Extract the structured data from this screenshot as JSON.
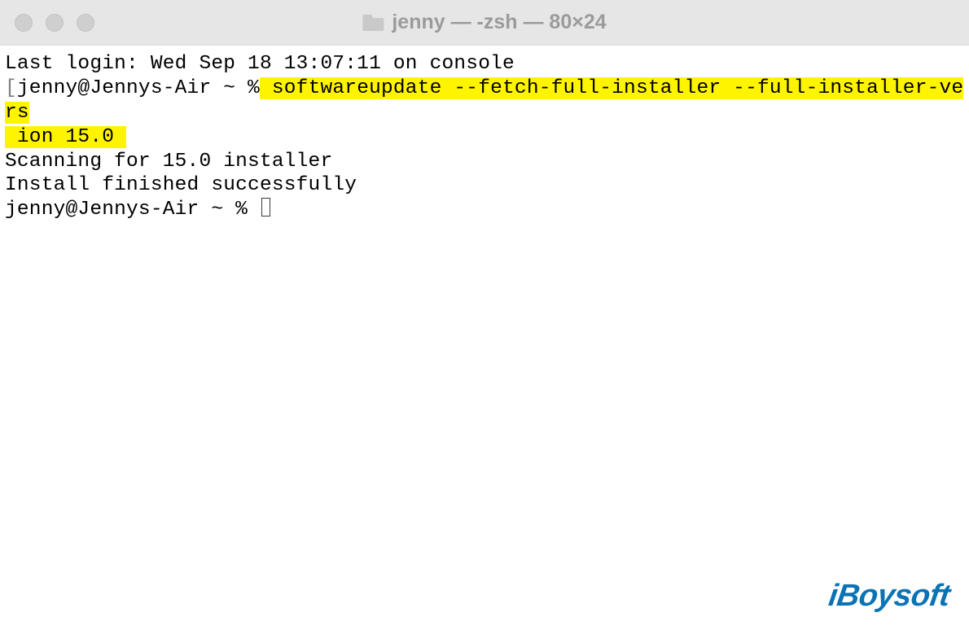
{
  "titlebar": {
    "title": "jenny — -zsh — 80×24"
  },
  "terminal": {
    "last_login": "Last login: Wed Sep 18 13:07:11 on console",
    "bracket": "[",
    "prompt1": "jenny@Jennys-Air ~ %",
    "highlighted_command_part1": " softwareupdate --fetch-full-installer --full-installer-vers",
    "highlighted_command_part2": " ion 15.0 ",
    "scanning": "Scanning for 15.0 installer",
    "install_finished": "Install finished successfully",
    "prompt2": "jenny@Jennys-Air ~ % "
  },
  "watermark": {
    "text": "iBoysoft"
  }
}
